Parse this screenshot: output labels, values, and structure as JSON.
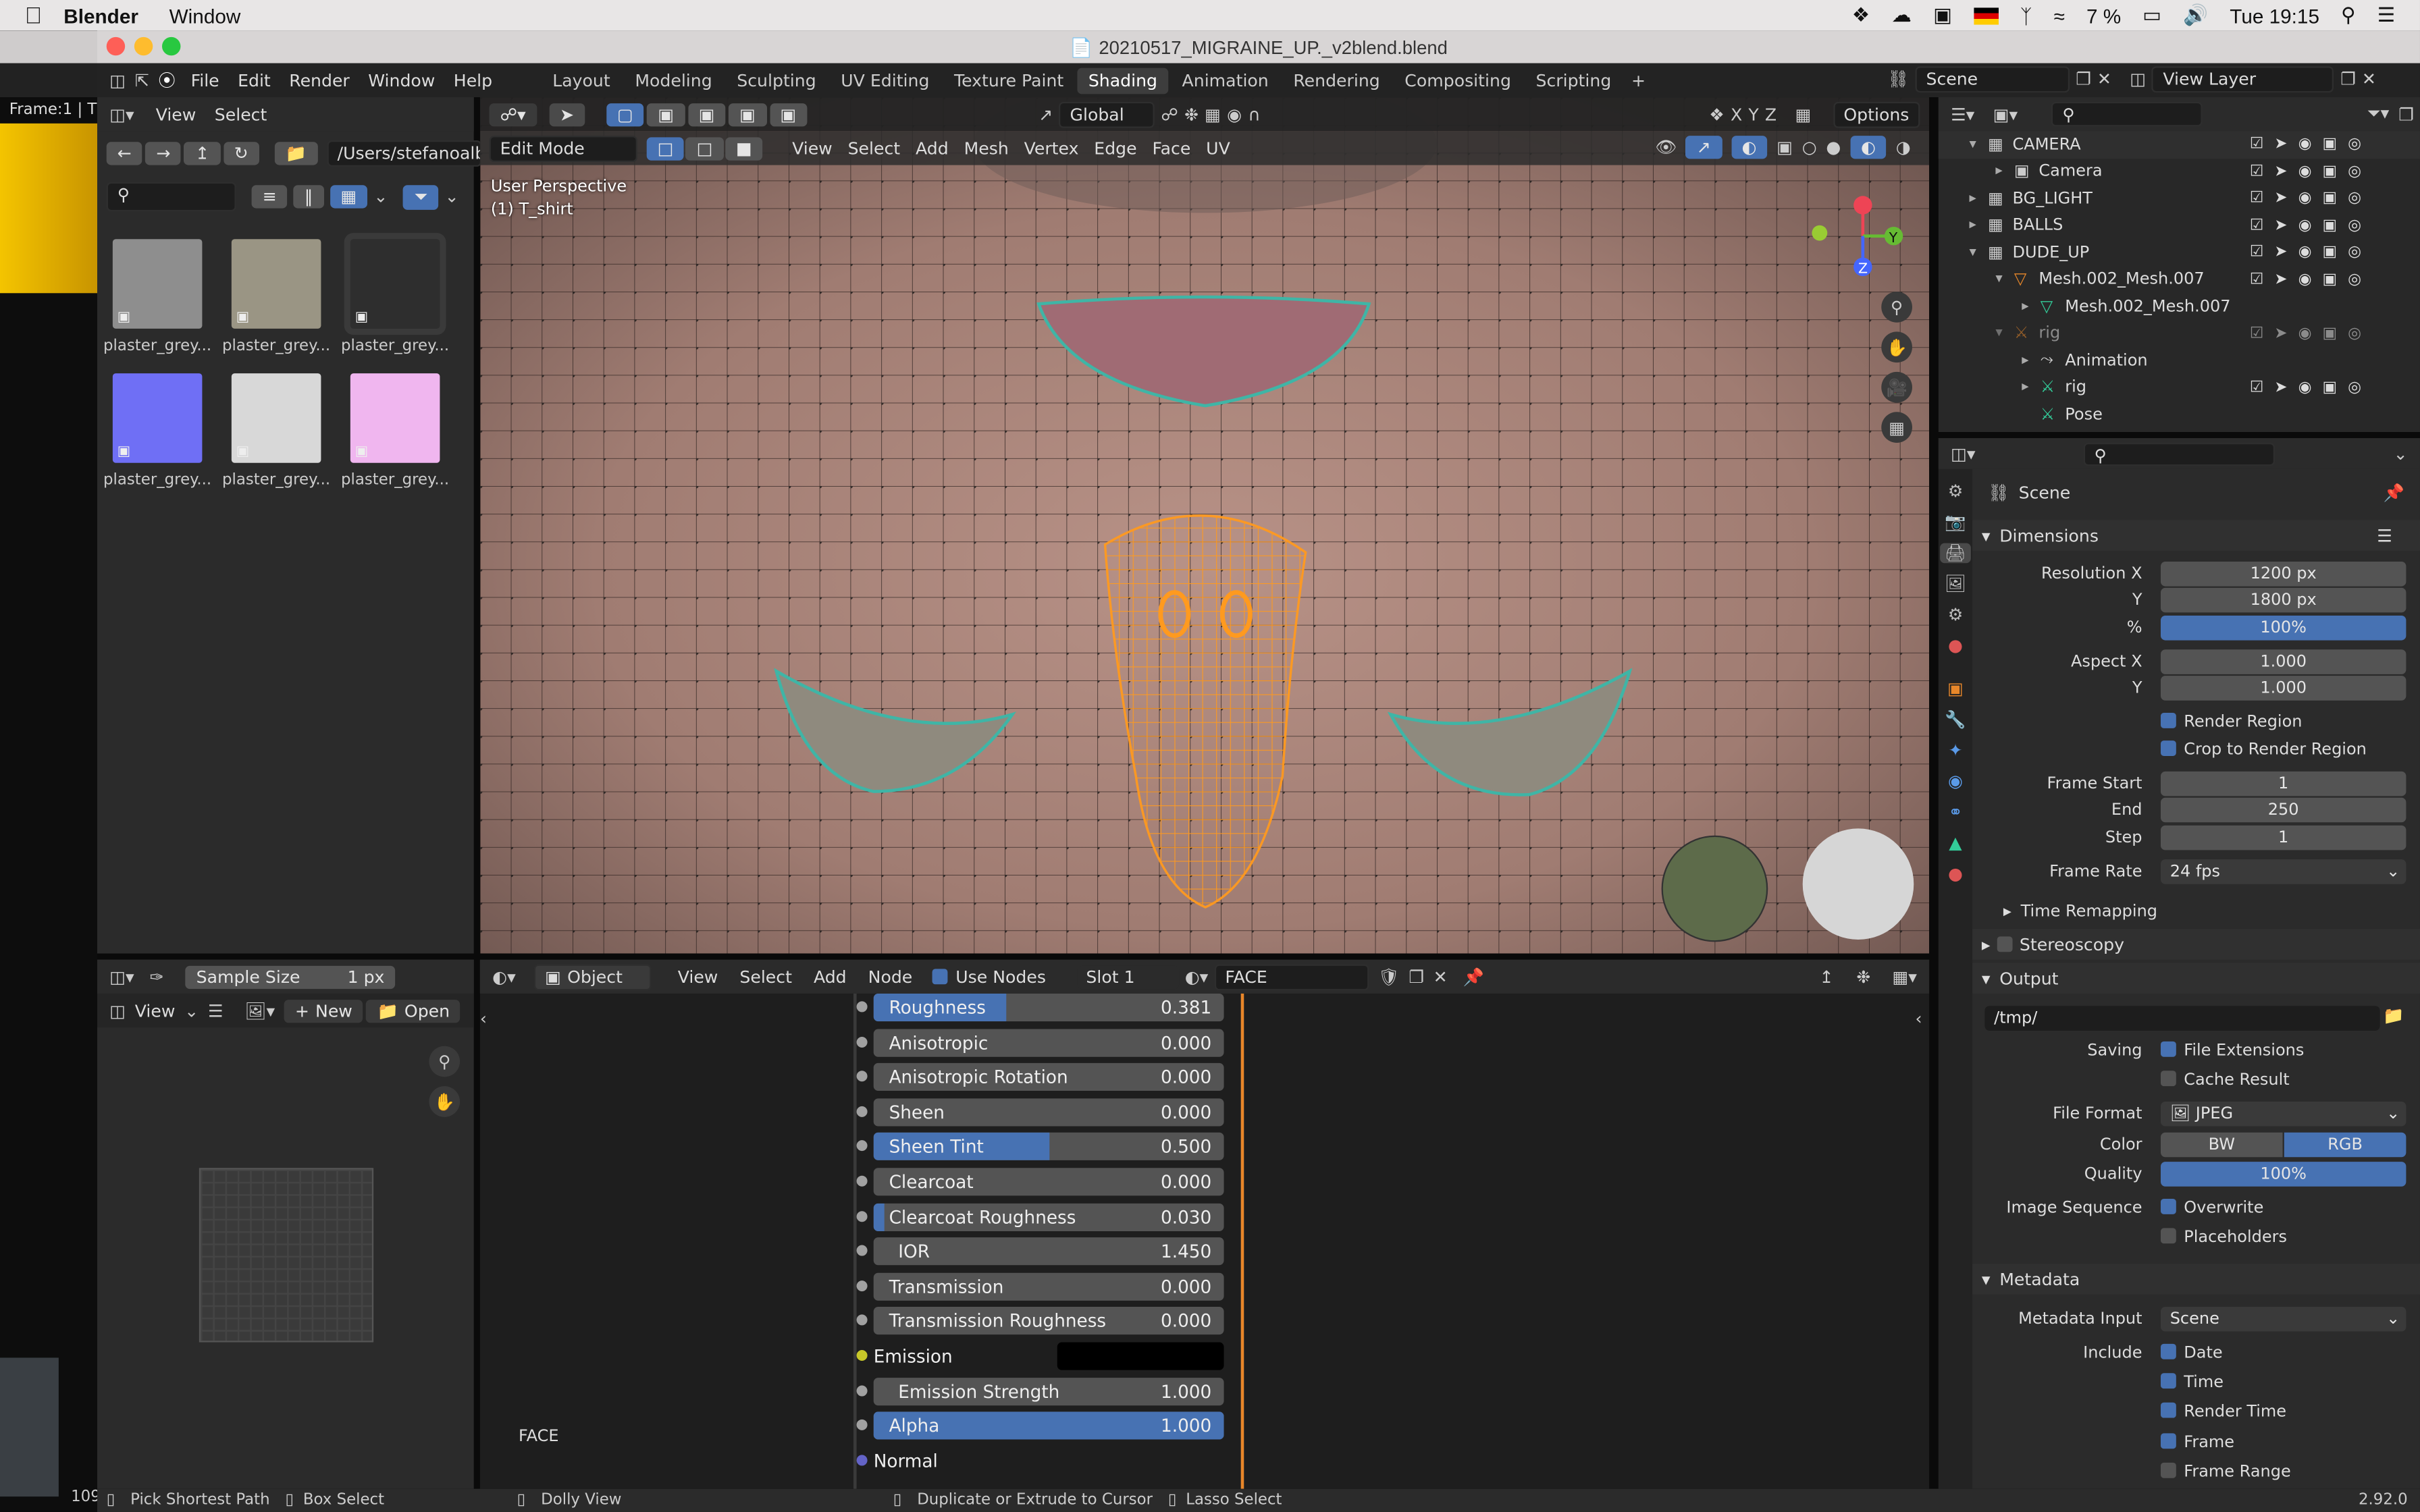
{
  "menubar": {
    "apple": "",
    "app": "Blender",
    "window": "Window",
    "battery": "7 %",
    "clock": "Tue 19:15"
  },
  "titlebar": {
    "title": "20210517_MIGRAINE_UP._v2blend.blend"
  },
  "left_strip": {
    "frame": "Frame:1 | T",
    "num": "109"
  },
  "topbar": {
    "menus": [
      "File",
      "Edit",
      "Render",
      "Window",
      "Help"
    ],
    "workspaces": [
      "Layout",
      "Modeling",
      "Sculpting",
      "UV Editing",
      "Texture Paint",
      "Shading",
      "Animation",
      "Rendering",
      "Compositing",
      "Scripting"
    ],
    "active_workspace": "Shading",
    "scene": "Scene",
    "view_layer": "View Layer"
  },
  "filebrowser": {
    "view": "View",
    "select": "Select",
    "path": "/Users/stefanoalbu...",
    "thumbs": [
      {
        "label": "plaster_grey...",
        "color": "#8e8e8e"
      },
      {
        "label": "plaster_grey...",
        "color": "#9a9584"
      },
      {
        "label": "plaster_grey...",
        "color": "#2e2e2e"
      },
      {
        "label": "plaster_grey...",
        "color": "#6f6ff5"
      },
      {
        "label": "plaster_grey...",
        "color": "#d8d8d8"
      },
      {
        "label": "plaster_grey...",
        "color": "#f0b6ef"
      }
    ]
  },
  "viewport": {
    "orientation": "Global",
    "options": "Options",
    "mode": "Edit Mode",
    "menus": [
      "View",
      "Select",
      "Add",
      "Mesh",
      "Vertex",
      "Edge",
      "Face",
      "UV"
    ],
    "perspective": "User Perspective",
    "object": "(1) T_shirt",
    "axes": {
      "x": "X",
      "y": "Y",
      "z": "Z"
    }
  },
  "outliner": {
    "rows": [
      {
        "indent": 0,
        "name": "CAMERA",
        "arrow": "▾"
      },
      {
        "indent": 1,
        "name": "Camera",
        "arrow": "▸"
      },
      {
        "indent": 0,
        "name": "BG_LIGHT",
        "arrow": "▸"
      },
      {
        "indent": 0,
        "name": "BALLS",
        "arrow": "▸"
      },
      {
        "indent": 0,
        "name": "DUDE_UP",
        "arrow": "▾"
      },
      {
        "indent": 1,
        "name": "Mesh.002_Mesh.007",
        "arrow": "▾"
      },
      {
        "indent": 2,
        "name": "Mesh.002_Mesh.007",
        "arrow": "▸"
      },
      {
        "indent": 1,
        "name": "rig",
        "arrow": "▾"
      },
      {
        "indent": 2,
        "name": "Animation",
        "arrow": "▸"
      },
      {
        "indent": 2,
        "name": "rig",
        "arrow": "▸"
      },
      {
        "indent": 2,
        "name": "Pose",
        "arrow": ""
      }
    ]
  },
  "properties": {
    "context": "Scene",
    "dimensions": {
      "title": "Dimensions",
      "res_x_label": "Resolution X",
      "res_x": "1200 px",
      "res_y_label": "Y",
      "res_y": "1800 px",
      "pct_label": "%",
      "pct": "100%",
      "aspect_x_label": "Aspect X",
      "aspect_x": "1.000",
      "aspect_y_label": "Y",
      "aspect_y": "1.000",
      "render_region": "Render Region",
      "crop": "Crop to Render Region",
      "frame_start_label": "Frame Start",
      "frame_start": "1",
      "end_label": "End",
      "end": "250",
      "step_label": "Step",
      "step": "1",
      "frame_rate_label": "Frame Rate",
      "frame_rate": "24 fps",
      "time_remap": "Time Remapping",
      "stereo": "Stereoscopy"
    },
    "output": {
      "title": "Output",
      "path": "/tmp/",
      "saving_label": "Saving",
      "file_ext": "File Extensions",
      "cache": "Cache Result",
      "format_label": "File Format",
      "format": "JPEG",
      "color_label": "Color",
      "bw": "BW",
      "rgb": "RGB",
      "quality_label": "Quality",
      "quality": "100%",
      "seq_label": "Image Sequence",
      "overwrite": "Overwrite",
      "placeholders": "Placeholders"
    },
    "metadata": {
      "title": "Metadata",
      "input_label": "Metadata Input",
      "input": "Scene",
      "include_label": "Include",
      "items": [
        "Date",
        "Time",
        "Render Time",
        "Frame",
        "Frame Range"
      ],
      "checked": [
        true,
        true,
        true,
        true,
        false
      ]
    },
    "version": "2.92.0"
  },
  "image_editor": {
    "sample_label": "Sample Size",
    "sample_val": "1 px",
    "view": "View",
    "new": "New",
    "open": "Open"
  },
  "node_editor": {
    "object": "Object",
    "menus": [
      "View",
      "Select",
      "Add",
      "Node"
    ],
    "use_nodes": "Use Nodes",
    "slot": "Slot 1",
    "material": "FACE",
    "frame_label": "FACE",
    "sockets": [
      {
        "label": "Roughness",
        "value": "0.381",
        "fill": 0.381
      },
      {
        "label": "Anisotropic",
        "value": "0.000",
        "fill": 0
      },
      {
        "label": "Anisotropic Rotation",
        "value": "0.000",
        "fill": 0
      },
      {
        "label": "Sheen",
        "value": "0.000",
        "fill": 0
      },
      {
        "label": "Sheen Tint",
        "value": "0.500",
        "fill": 0.5
      },
      {
        "label": "Clearcoat",
        "value": "0.000",
        "fill": 0
      },
      {
        "label": "Clearcoat Roughness",
        "value": "0.030",
        "fill": 0.03
      },
      {
        "label": "IOR",
        "value": "1.450",
        "fill": 0
      },
      {
        "label": "Transmission",
        "value": "0.000",
        "fill": 0
      },
      {
        "label": "Transmission Roughness",
        "value": "0.000",
        "fill": 0
      },
      {
        "label": "Emission",
        "value": "",
        "fill": 0
      },
      {
        "label": "Emission Strength",
        "value": "1.000",
        "fill": 0
      },
      {
        "label": "Alpha",
        "value": "1.000",
        "fill": 1
      },
      {
        "label": "Normal",
        "value": "",
        "fill": 0
      }
    ]
  },
  "status": {
    "items": [
      "Pick Shortest Path",
      "Box Select",
      "Dolly View",
      "Duplicate or Extrude to Cursor",
      "Lasso Select"
    ],
    "version": "2.92.0"
  }
}
